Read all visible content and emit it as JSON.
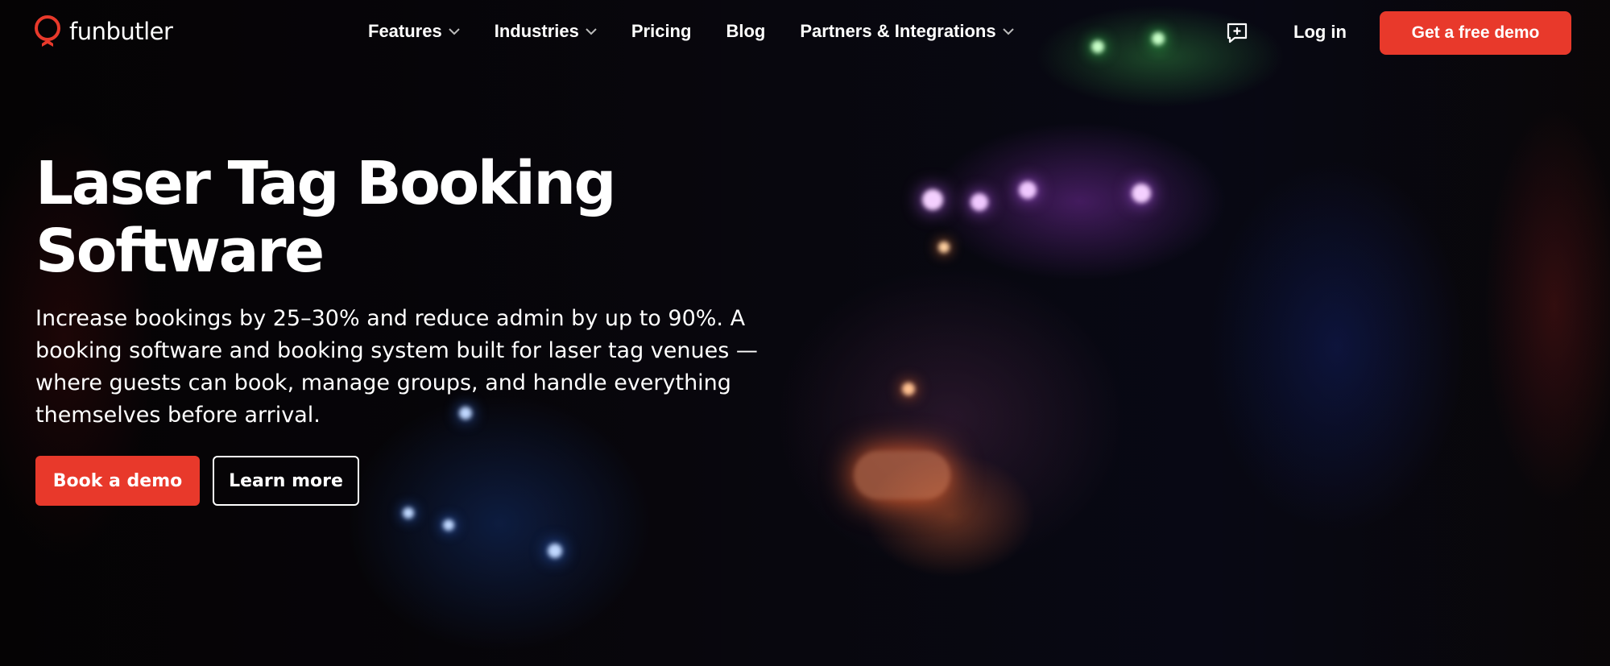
{
  "brand": {
    "name": "funbutler",
    "accent": "#e8392b"
  },
  "nav": {
    "items": [
      {
        "label": "Features",
        "has_dropdown": true
      },
      {
        "label": "Industries",
        "has_dropdown": true
      },
      {
        "label": "Pricing",
        "has_dropdown": false
      },
      {
        "label": "Blog",
        "has_dropdown": false
      },
      {
        "label": "Partners & Integrations",
        "has_dropdown": true
      }
    ],
    "chat_icon": "chat-plus-icon",
    "login_label": "Log in",
    "cta_label": "Get a free demo"
  },
  "hero": {
    "title": "Laser Tag Booking Software",
    "subtitle": "Increase bookings by 25–30% and reduce admin by up to 90%. A booking software and booking system built for laser tag venues — where guests can book, manage groups, and handle everything themselves before arrival.",
    "primary_button": "Book a demo",
    "secondary_button": "Learn more"
  }
}
